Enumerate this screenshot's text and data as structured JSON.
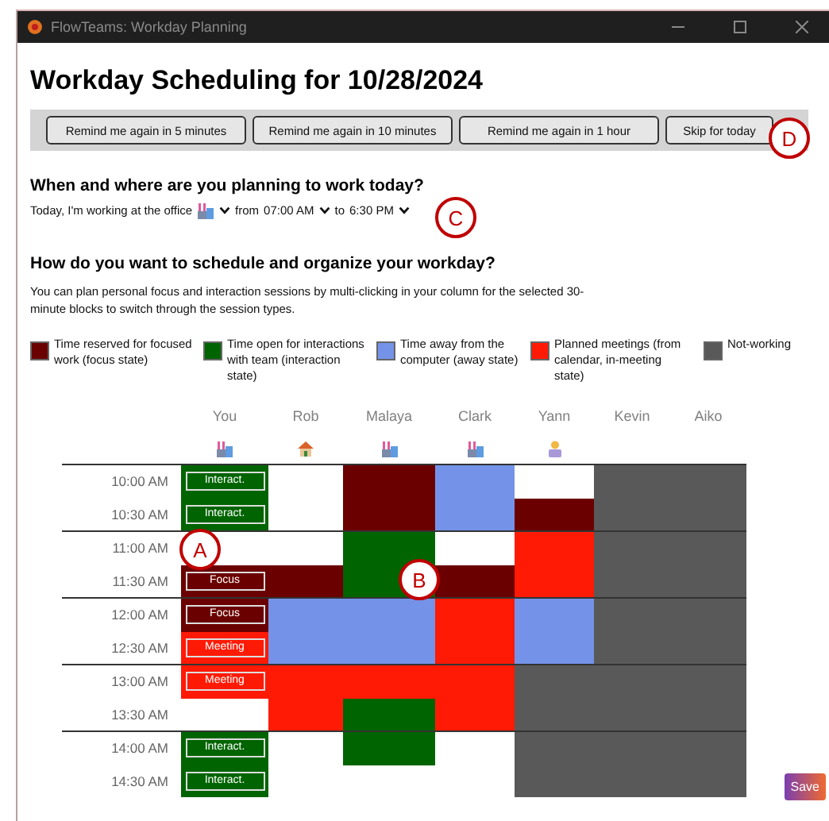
{
  "window": {
    "title": "FlowTeams: Workday Planning"
  },
  "heading": "Workday Scheduling for 10/28/2024",
  "reminder_buttons": [
    "Remind me again in 5 minutes",
    "Remind me again in 10 minutes",
    "Remind me again in 1 hour",
    "Skip for today"
  ],
  "when_section": {
    "heading": "When and where are you planning to work today?",
    "prefix": "Today, I'm working at the office",
    "location": {
      "kind": "office"
    },
    "from_label": "from",
    "from_time": "07:00 AM",
    "to_label": "to",
    "to_time": "6:30 PM"
  },
  "schedule_section": {
    "heading": "How do you want to schedule and organize your workday?",
    "description": "You can plan personal focus and interaction sessions by multi-clicking in your column for the selected 30-minute blocks to switch through the session types."
  },
  "legend": [
    {
      "label": "Time reserved for focused work (focus state)",
      "color": "#6b0000"
    },
    {
      "label": "Time open for interactions with team (interaction state)",
      "color": "#006400"
    },
    {
      "label": "Time away from the computer (away state)",
      "color": "#7493e8"
    },
    {
      "label": "Planned meetings (from calendar, in-meeting state)",
      "color": "#ff1a05"
    },
    {
      "label": "Not-working",
      "color": "#595959"
    }
  ],
  "people": [
    {
      "name": "You",
      "location": {
        "kind": "office"
      }
    },
    {
      "name": "Rob",
      "location": {
        "kind": "home"
      }
    },
    {
      "name": "Malaya",
      "location": {
        "kind": "office"
      }
    },
    {
      "name": "Clark",
      "location": {
        "kind": "office"
      }
    },
    {
      "name": "Yann",
      "location": {
        "kind": "remote"
      }
    },
    {
      "name": "Kevin"
    },
    {
      "name": "Aiko"
    }
  ],
  "rows": [
    {
      "time": "10:00 AM",
      "cells": [
        {
          "kind": "interact",
          "label": "Interact."
        },
        {
          "kind": "empty"
        },
        {
          "kind": "focus"
        },
        {
          "kind": "away"
        },
        {
          "kind": "empty"
        },
        {
          "kind": "off"
        },
        {
          "kind": "off"
        }
      ]
    },
    {
      "time": "10:30 AM",
      "cells": [
        {
          "kind": "interact",
          "label": "Interact."
        },
        {
          "kind": "empty"
        },
        {
          "kind": "focus"
        },
        {
          "kind": "away"
        },
        {
          "kind": "focus"
        },
        {
          "kind": "off"
        },
        {
          "kind": "off"
        }
      ]
    },
    {
      "time": "11:00 AM",
      "cells": [
        {
          "kind": "empty"
        },
        {
          "kind": "empty"
        },
        {
          "kind": "interact"
        },
        {
          "kind": "empty"
        },
        {
          "kind": "meeting"
        },
        {
          "kind": "off"
        },
        {
          "kind": "off"
        }
      ]
    },
    {
      "time": "11:30 AM",
      "cells": [
        {
          "kind": "focus",
          "label": "Focus"
        },
        {
          "kind": "focus"
        },
        {
          "kind": "interact"
        },
        {
          "kind": "focus"
        },
        {
          "kind": "meeting"
        },
        {
          "kind": "off"
        },
        {
          "kind": "off"
        }
      ]
    },
    {
      "time": "12:00 AM",
      "cells": [
        {
          "kind": "focus",
          "label": "Focus"
        },
        {
          "kind": "away"
        },
        {
          "kind": "away"
        },
        {
          "kind": "meeting"
        },
        {
          "kind": "away"
        },
        {
          "kind": "off"
        },
        {
          "kind": "off"
        }
      ]
    },
    {
      "time": "12:30 AM",
      "cells": [
        {
          "kind": "meeting",
          "label": "Meeting"
        },
        {
          "kind": "away"
        },
        {
          "kind": "away"
        },
        {
          "kind": "meeting"
        },
        {
          "kind": "away"
        },
        {
          "kind": "off"
        },
        {
          "kind": "off"
        }
      ]
    },
    {
      "time": "13:00 AM",
      "cells": [
        {
          "kind": "meeting",
          "label": "Meeting"
        },
        {
          "kind": "meeting"
        },
        {
          "kind": "meeting"
        },
        {
          "kind": "meeting"
        },
        {
          "kind": "off"
        },
        {
          "kind": "off"
        },
        {
          "kind": "off"
        }
      ]
    },
    {
      "time": "13:30 AM",
      "cells": [
        {
          "kind": "empty"
        },
        {
          "kind": "meeting"
        },
        {
          "kind": "interact"
        },
        {
          "kind": "meeting"
        },
        {
          "kind": "off"
        },
        {
          "kind": "off"
        },
        {
          "kind": "off"
        }
      ]
    },
    {
      "time": "14:00 AM",
      "cells": [
        {
          "kind": "interact",
          "label": "Interact."
        },
        {
          "kind": "empty"
        },
        {
          "kind": "interact"
        },
        {
          "kind": "empty"
        },
        {
          "kind": "off"
        },
        {
          "kind": "off"
        },
        {
          "kind": "off"
        }
      ]
    },
    {
      "time": "14:30 AM",
      "cells": [
        {
          "kind": "interact",
          "label": "Interact."
        },
        {
          "kind": "empty"
        },
        {
          "kind": "empty"
        },
        {
          "kind": "empty"
        },
        {
          "kind": "off"
        },
        {
          "kind": "off"
        },
        {
          "kind": "off"
        }
      ]
    }
  ],
  "callouts": [
    "D",
    "C",
    "A",
    "B"
  ],
  "save_button": "Save"
}
